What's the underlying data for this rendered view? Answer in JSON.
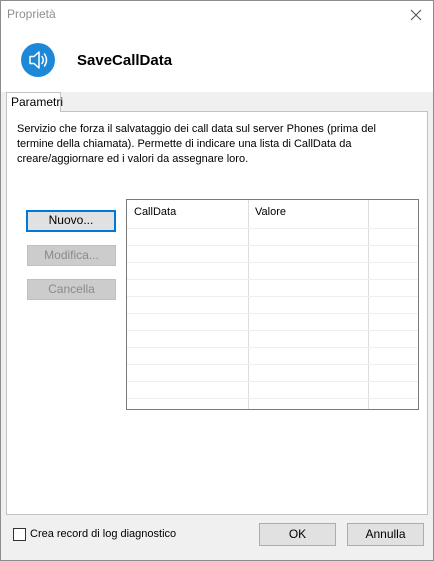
{
  "window": {
    "title": "Proprietà",
    "close_icon": "close-icon"
  },
  "header": {
    "icon": "speaker-icon",
    "icon_color": "#1e88d8",
    "title": "SaveCallData"
  },
  "tabs": [
    {
      "label": "Parametri",
      "active": true
    }
  ],
  "panel": {
    "description": "Servizio che forza il salvataggio dei call data sul server Phones (prima del termine della chiamata). Permette di indicare una lista di CallData da creare/aggiornare ed i valori da assegnare loro.",
    "buttons": {
      "new_label": "Nuovo...",
      "edit_label": "Modifica...",
      "delete_label": "Cancella"
    },
    "grid": {
      "columns": [
        "CallData",
        "Valore"
      ],
      "rows": []
    }
  },
  "footer": {
    "checkbox_label": "Crea record di log diagnostico",
    "checkbox_checked": false,
    "ok_label": "OK",
    "cancel_label": "Annulla",
    "accent_color": "#0078d7"
  }
}
